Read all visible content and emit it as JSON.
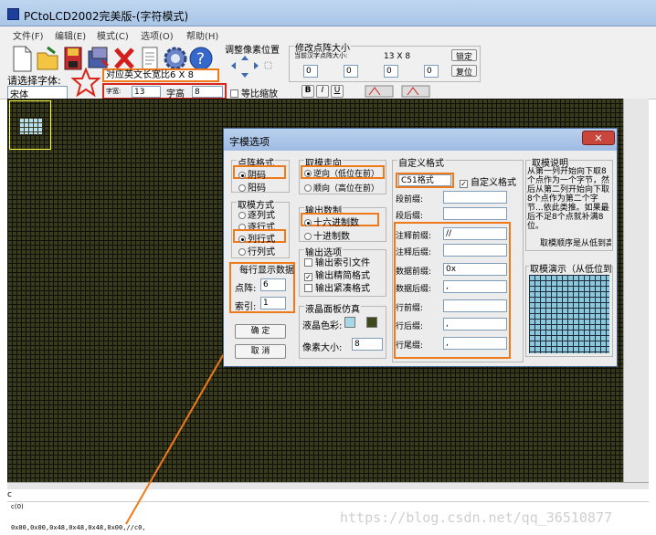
{
  "window": {
    "title": "PCtoLCD2002完美版-(字符模式)"
  },
  "menu": [
    "文件(F)",
    "编辑(E)",
    "模式(C)",
    "选项(O)",
    "帮助(H)"
  ],
  "toolbar": {
    "icons": [
      "new-icon",
      "open-icon",
      "save-icon",
      "export-icon",
      "delete-icon",
      "document-icon",
      "settings-gear-icon",
      "help-icon"
    ],
    "adjust_pixel_label": "调整像素位置",
    "resize_group_label": "修改点阵大小",
    "current_size_label": "当前汉字点阵大小:",
    "current_size_value": "13 X 8",
    "lock_button": "锁定",
    "restore_button": "复位",
    "spin_values": [
      "0",
      "0",
      "0",
      "0"
    ],
    "font_label": "请选择字体:",
    "font_value": "宋体",
    "font_desc": "对应英文长宽比6 X 8",
    "width_label": "字宽:",
    "width_value": "13",
    "height_label": "字高",
    "height_value": "8",
    "scale_label": "等比缩放",
    "bold_btn": "B",
    "italic_btn": "I",
    "underline_btn": "U"
  },
  "dialog": {
    "title": "字模选项",
    "dot_format": {
      "label": "点阵格式",
      "options": [
        "阴码",
        "阳码"
      ],
      "selected": 0
    },
    "scan_mode": {
      "label": "取模方式",
      "options": [
        "逐列式",
        "逐行式",
        "列行式",
        "行列式"
      ],
      "selected": 2
    },
    "per_line": {
      "label": "每行显示数据",
      "dot_label": "点阵:",
      "dot_value": "6",
      "index_label": "索引:",
      "index_value": "1"
    },
    "ok_button": "确 定",
    "cancel_button": "取 消",
    "direction": {
      "label": "取模走向",
      "options": [
        "逆向（低位在前）",
        "顺向（高位在前）"
      ],
      "selected": 0
    },
    "radix": {
      "label": "输出数制",
      "options": [
        "十六进制数",
        "十进制数"
      ],
      "selected": 0
    },
    "output": {
      "label": "输出选项",
      "options": [
        "输出索引文件",
        "输出精简格式",
        "输出紧凑格式"
      ],
      "checked": [
        false,
        true,
        false
      ]
    },
    "lcd": {
      "label": "液晶面板仿真",
      "color_label": "液晶色彩:",
      "pixel_label": "像素大小:",
      "pixel_value": "8",
      "color_on": "#a8d8e8",
      "color_off": "#3e4a1e"
    },
    "custom": {
      "label": "自定义格式",
      "format_value": "C51格式",
      "custom_check": "自定义格式",
      "fields": [
        {
          "label": "段前缀:",
          "value": ""
        },
        {
          "label": "段后缀:",
          "value": ""
        },
        {
          "label": "注释前缀:",
          "value": "//"
        },
        {
          "label": "注释后缀:",
          "value": ""
        },
        {
          "label": "数据前缀:",
          "value": "0x"
        },
        {
          "label": "数据后缀:",
          "value": ","
        },
        {
          "label": "行前缀:",
          "value": ""
        },
        {
          "label": "行后缀:",
          "value": ","
        },
        {
          "label": "行尾缀:",
          "value": ","
        }
      ]
    },
    "explain": {
      "label": "取模说明",
      "text": "从第一列开始向下取8个点作为一个字节，然后从第二列开始向下取8个点作为第二个字节...依此类推。如果最后不足8个点就补满8位。",
      "order": "取模顺序是从低到高"
    },
    "demo": {
      "label": "取模演示（从低位到高位）"
    }
  },
  "status": {
    "char": "c",
    "line1": "c(0)",
    "output": "0x00,0x00,0x48,0x48,0x48,0x00,//c0,"
  },
  "watermark": "https://blog.csdn.net/qq_36510877"
}
